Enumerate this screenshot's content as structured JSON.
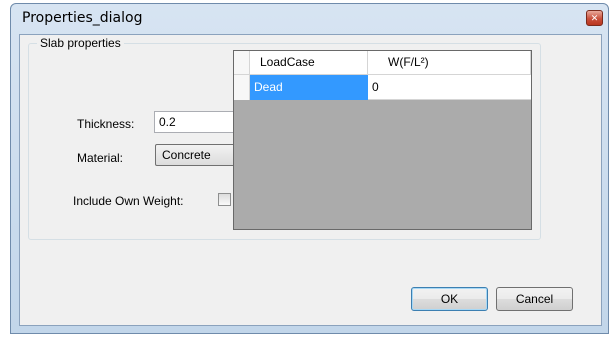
{
  "window": {
    "title": "Properties_dialog",
    "close_glyph": "✕"
  },
  "group": {
    "legend": "Slab properties"
  },
  "form": {
    "thickness_label": "Thickness:",
    "thickness_value": "0.2",
    "material_label": "Material:",
    "material_value": "Concrete",
    "own_weight_label": "Include Own Weight:",
    "own_weight_checked": false
  },
  "grid": {
    "columns": [
      "LoadCase",
      "W(F/L²)"
    ],
    "rows": [
      [
        "Dead",
        "0"
      ]
    ],
    "selected_row": 0
  },
  "buttons": {
    "ok": "OK",
    "cancel": "Cancel"
  },
  "colors": {
    "selection": "#3399ff",
    "grid_background": "#ababab",
    "chrome": "#c7daed"
  },
  "icons": {
    "close": "close-icon",
    "dropdown": "chevron-down-icon"
  }
}
